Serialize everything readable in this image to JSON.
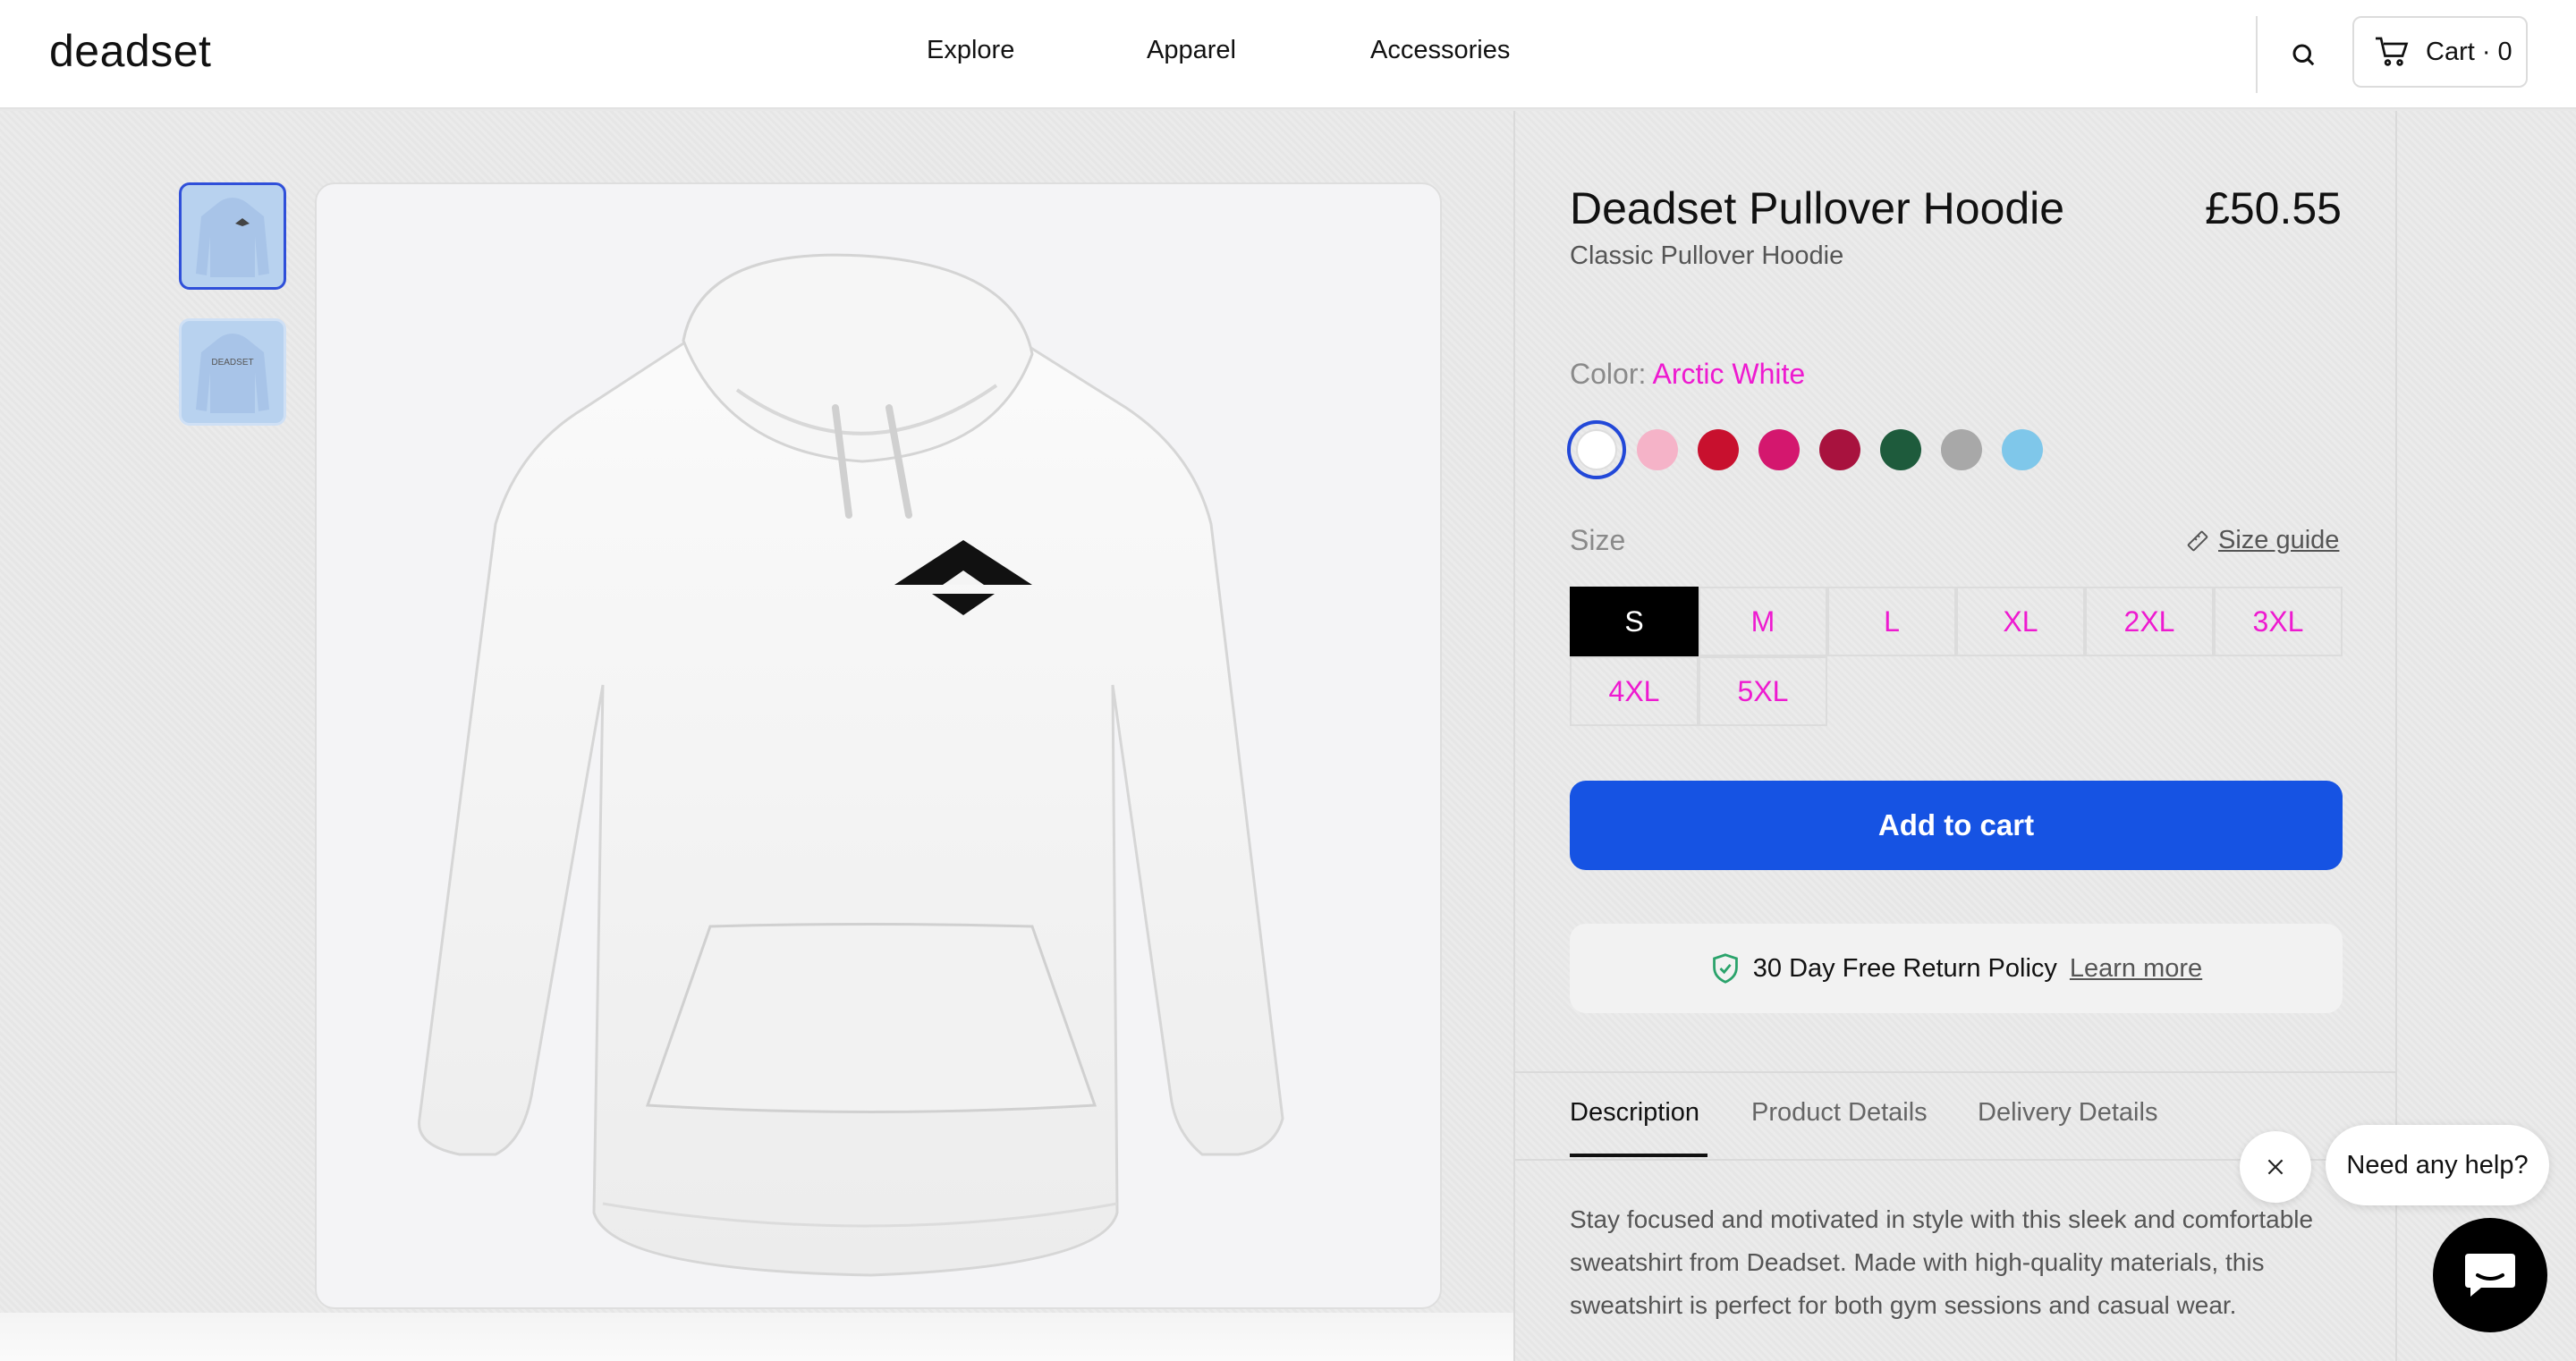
{
  "header": {
    "logo": "deadset",
    "nav": [
      "Explore",
      "Apparel",
      "Accessories"
    ],
    "cart_label": "Cart · 0"
  },
  "gallery": {
    "thumb_back_text": "DEADSET"
  },
  "product": {
    "title": "Deadset Pullover Hoodie",
    "price": "£50.55",
    "subtitle": "Classic Pullover Hoodie",
    "color_label": "Color:",
    "color_value": "Arctic White",
    "swatches": [
      "#ffffff",
      "#f5b3c8",
      "#c8102e",
      "#d4176e",
      "#a8123e",
      "#1e5b3c",
      "#a8a8a8",
      "#7fc7ea"
    ],
    "size_label": "Size",
    "size_guide": "Size guide",
    "sizes": [
      "S",
      "M",
      "L",
      "XL",
      "2XL",
      "3XL",
      "4XL",
      "5XL"
    ],
    "selected_size": "S",
    "add_to_cart": "Add to cart",
    "return_policy": "30 Day Free Return Policy",
    "learn_more": "Learn more"
  },
  "tabs": [
    "Description",
    "Product Details",
    "Delivery Details"
  ],
  "description": "Stay focused and motivated in style with this sleek and comfortable sweatshirt from Deadset. Made with high-quality materials, this sweatshirt is perfect for both gym sessions and casual wear.",
  "chat": {
    "prompt": "Need any help?"
  },
  "colors": {
    "accent_blue": "#1653e3",
    "highlight_magenta": "#ee1ad0",
    "return_shield_green": "#2aa36b"
  }
}
